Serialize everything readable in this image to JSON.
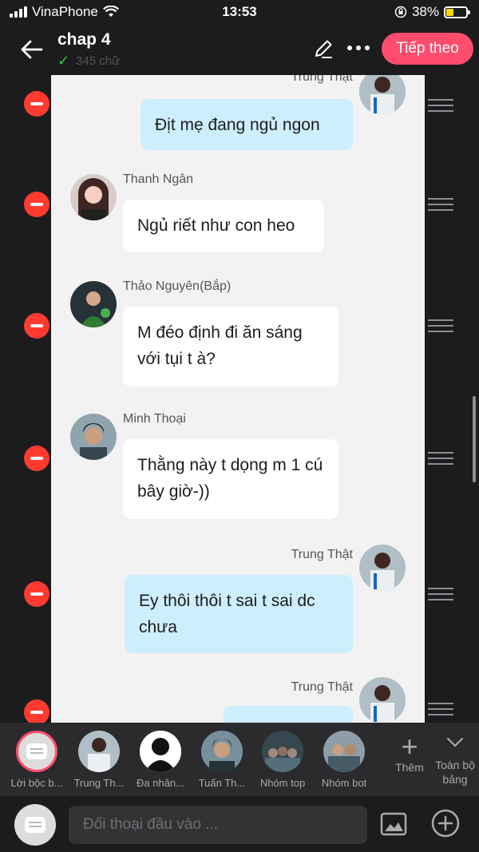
{
  "status": {
    "carrier": "VinaPhone",
    "time": "13:53",
    "battery": "38%"
  },
  "header": {
    "title": "chap 4",
    "word_count": "345 chữ",
    "next_label": "Tiếp theo"
  },
  "messages": [
    {
      "sender": "Trung Thật",
      "side": "right",
      "text": "Địt mẹ đang ngủ ngon"
    },
    {
      "sender": "Thanh Ngân",
      "side": "left",
      "text": "Ngủ riết như con heo"
    },
    {
      "sender": "Thảo Nguyên(Bắp)",
      "side": "left",
      "text": "M đéo định đi ăn sáng với tụi t à?"
    },
    {
      "sender": "Minh Thoại",
      "side": "left",
      "text": "Thằng này t dọng m 1 cú bây giờ-))"
    },
    {
      "sender": "Trung Thật",
      "side": "right",
      "text": "Ey thôi thôi t sai t sai dc chưa"
    },
    {
      "sender": "Trung Thật",
      "side": "right",
      "text": ""
    }
  ],
  "characters": [
    {
      "name": "Lời bộc b..."
    },
    {
      "name": "Trung Th..."
    },
    {
      "name": "Đa nhân..."
    },
    {
      "name": "Tuấn Th..."
    },
    {
      "name": "Nhóm top"
    },
    {
      "name": "Nhóm bot"
    }
  ],
  "add_label": "Thêm",
  "all_board_label": "Toàn bộ bảng",
  "input": {
    "placeholder": "Đối thoại đầu vào ..."
  },
  "colors": {
    "accent": "#ff4d6d",
    "delete": "#ff3b30",
    "right_bubble": "#cdeefc"
  }
}
